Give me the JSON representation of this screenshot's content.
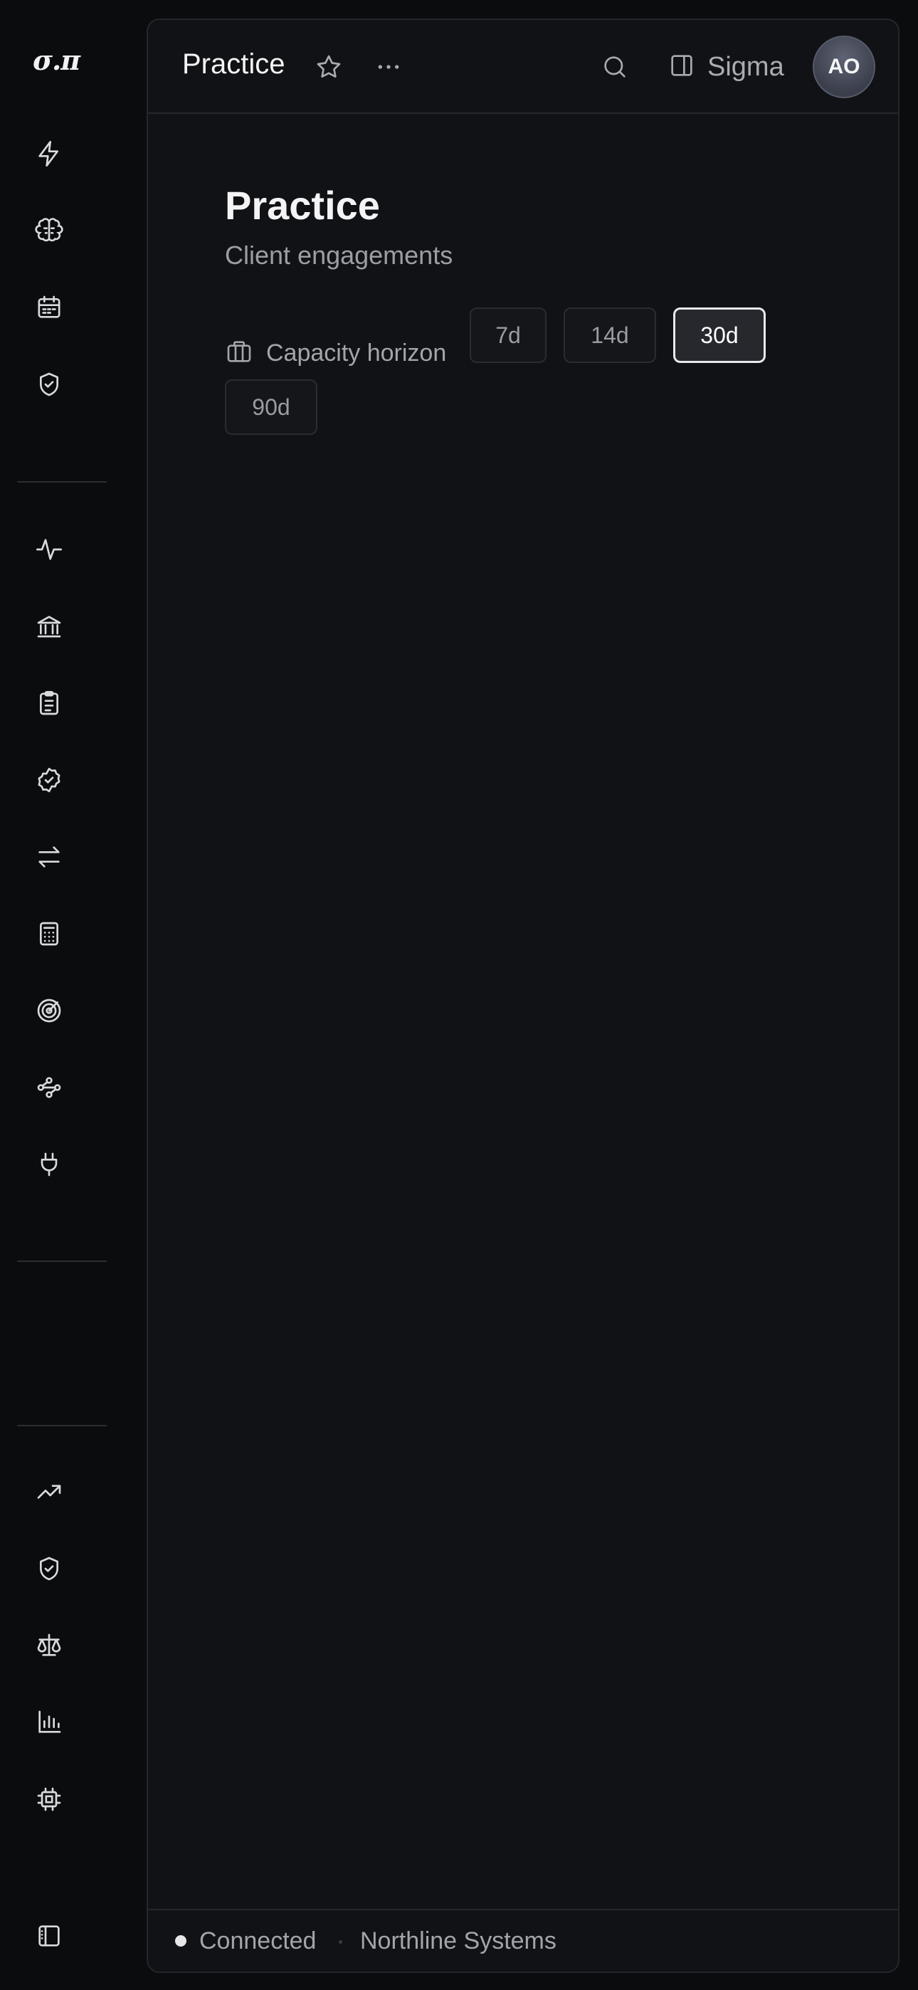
{
  "rail": {
    "logo": "σ.π",
    "icons": [
      "lightning-icon",
      "brain-icon",
      "calendar-icon",
      "shield-check-icon",
      "activity-icon",
      "bank-icon",
      "clipboard-list-icon",
      "badge-check-icon",
      "arrows-left-right-icon",
      "calculator-icon",
      "target-icon",
      "workflow-icon",
      "plug-icon",
      "trending-up-icon",
      "shield-check-icon",
      "scale-icon",
      "bar-chart-icon",
      "cpu-icon",
      "sidebar-toggle-icon"
    ]
  },
  "header": {
    "title": "Practice",
    "workspace_label": "Sigma",
    "avatar_initials": "AO"
  },
  "main": {
    "title": "Practice",
    "subtitle": "Client engagements",
    "horizon_label": "Capacity horizon",
    "horizon_options": [
      "7d",
      "14d",
      "30d",
      "90d"
    ],
    "horizon_selected": "30d"
  },
  "status": {
    "connection": "Connected",
    "organization": "Northline Systems"
  },
  "colors": {
    "background": "#0b0c0e",
    "panel": "#111215",
    "border": "#24262b",
    "text_primary": "#f4f4f6",
    "text_secondary": "#a3a5ab",
    "chip_active_border": "#e9e9ec"
  }
}
